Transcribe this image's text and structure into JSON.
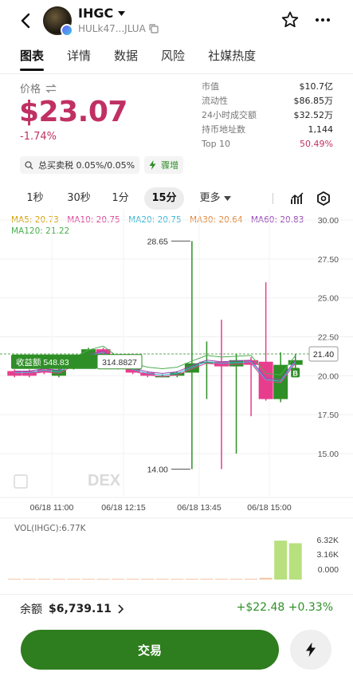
{
  "header": {
    "token_name": "IHGC",
    "token_address": "HULk47...JLUA"
  },
  "tabs": [
    "图表",
    "详情",
    "数据",
    "风险",
    "社媒热度"
  ],
  "price": {
    "label": "价格",
    "value": "$23.07",
    "change": "-1.74%"
  },
  "stats": [
    {
      "k": "市值",
      "v": "$10.7亿"
    },
    {
      "k": "流动性",
      "v": "$86.85万"
    },
    {
      "k": "24小时成交额",
      "v": "$32.52万"
    },
    {
      "k": "持币地址数",
      "v": "1,144"
    },
    {
      "k": "Top 10",
      "v": "50.49%"
    }
  ],
  "chips": {
    "tax": "总买卖税 0.05%/0.05%",
    "tag": "骤增"
  },
  "intervals": [
    "1秒",
    "30秒",
    "1分",
    "15分",
    "更多"
  ],
  "active_interval": "15分",
  "ma": {
    "ma5": "MA5: 20.73",
    "ma10": "MA10: 20.75",
    "ma20": "MA20: 20.75",
    "ma30": "MA30: 20.64",
    "ma60": "MA60: 20.83",
    "ma120": "MA120: 21.22"
  },
  "colors": {
    "up": "#2f8f27",
    "down": "#e83d8c",
    "accent": "#c03063",
    "ma5": "#d4a20a",
    "ma10": "#e0469b",
    "ma20": "#3bb7d6",
    "ma30": "#f0a64c",
    "ma60": "#9a4ab8",
    "ma120": "#4caf50"
  },
  "chart_data": {
    "type": "candlestick",
    "y_ticks": [
      "30.00",
      "27.50",
      "25.00",
      "22.50",
      "20.00",
      "17.50",
      "15.00"
    ],
    "ylim": [
      12.5,
      30.0
    ],
    "x_ticks": [
      "06/18 11:00",
      "06/18 12:15",
      "06/18 13:45",
      "06/18 15:00"
    ],
    "high_label": "28.65",
    "low_label": "14.00",
    "current_price": "21.40",
    "position_label": "收益额 548.83",
    "position_value": "314.8827",
    "trade_marker": "B",
    "watermark": "DEX",
    "candles": [
      {
        "o": 20.3,
        "c": 20.0,
        "h": 20.4,
        "l": 19.9
      },
      {
        "o": 20.3,
        "c": 20.0,
        "h": 20.4,
        "l": 19.9
      },
      {
        "o": 20.4,
        "c": 20.2,
        "h": 20.5,
        "l": 20.1
      },
      {
        "o": 20.0,
        "c": 20.4,
        "h": 20.5,
        "l": 19.9
      },
      {
        "o": 20.5,
        "c": 20.9,
        "h": 21.0,
        "l": 20.4
      },
      {
        "o": 20.7,
        "c": 21.7,
        "h": 21.8,
        "l": 20.6
      },
      {
        "o": 21.7,
        "c": 21.2,
        "h": 21.8,
        "l": 21.0
      },
      {
        "o": 21.0,
        "c": 20.5,
        "h": 21.1,
        "l": 20.4
      },
      {
        "o": 20.5,
        "c": 20.2,
        "h": 20.6,
        "l": 20.1
      },
      {
        "o": 20.2,
        "c": 20.0,
        "h": 20.3,
        "l": 19.9
      },
      {
        "o": 20.0,
        "c": 20.0,
        "h": 20.1,
        "l": 19.9
      },
      {
        "o": 20.0,
        "c": 20.2,
        "h": 20.3,
        "l": 19.9
      },
      {
        "o": 20.2,
        "c": 20.8,
        "h": 28.65,
        "l": 14.0
      },
      {
        "o": 20.8,
        "c": 20.9,
        "h": 22.2,
        "l": 18.5
      },
      {
        "o": 20.9,
        "c": 20.6,
        "h": 23.6,
        "l": 14.0
      },
      {
        "o": 20.6,
        "c": 21.0,
        "h": 21.4,
        "l": 15.0
      },
      {
        "o": 21.0,
        "c": 20.7,
        "h": 21.2,
        "l": 17.4
      },
      {
        "o": 20.9,
        "c": 18.5,
        "h": 26.0,
        "l": 18.4
      },
      {
        "o": 18.5,
        "c": 20.7,
        "h": 21.5,
        "l": 18.3
      },
      {
        "o": 20.7,
        "c": 21.0,
        "h": 21.4,
        "l": 20.5
      }
    ]
  },
  "volume": {
    "label": "VOL(IHGC):6.77K",
    "ticks": [
      "6.32K",
      "3.16K",
      "0.000"
    ],
    "values": [
      0,
      0,
      0,
      0,
      0,
      0,
      0,
      0,
      0,
      0,
      0.05,
      0.05,
      0.1,
      0.15,
      0.1,
      0.1,
      0.15,
      0.3,
      6.77,
      6.32
    ]
  },
  "bottom": {
    "balance_label": "余额",
    "balance_value": "$6,739.11",
    "pnl": "+$22.48 +0.33%"
  },
  "trade_button": "交易"
}
